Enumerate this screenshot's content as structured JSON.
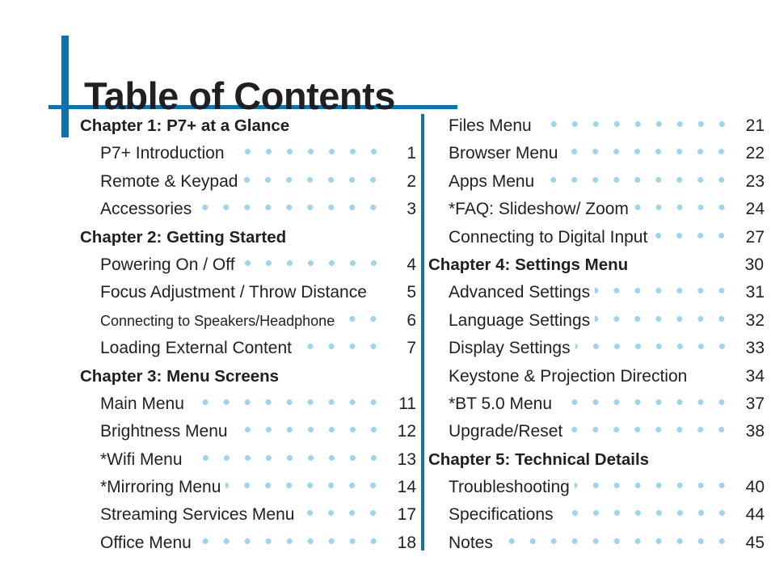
{
  "document": {
    "title": "Table of Contents",
    "accent_color": "#1272a8",
    "leader_dot_color": "#9ed5ea",
    "text_color": "#231f20"
  },
  "toc": {
    "left_column": [
      {
        "label": "Chapter 1: P7+ at a Glance",
        "page": "",
        "type": "chapter",
        "leader": false
      },
      {
        "label": "P7+ Introduction",
        "page": "1",
        "type": "entry",
        "leader": true
      },
      {
        "label": "Remote & Keypad",
        "page": "2",
        "type": "entry",
        "leader": true
      },
      {
        "label": "Accessories",
        "page": "3",
        "type": "entry",
        "leader": true
      },
      {
        "label": "Chapter 2: Getting Started",
        "page": "",
        "type": "chapter",
        "leader": false
      },
      {
        "label": "Powering On / Off",
        "page": "4",
        "type": "entry",
        "leader": true
      },
      {
        "label": "Focus Adjustment / Throw Distance",
        "page": "5",
        "type": "entry",
        "leader": false
      },
      {
        "label": "Connecting to Speakers/Headphone",
        "page": "6",
        "type": "entry-condensed",
        "leader": true
      },
      {
        "label": "Loading External Content",
        "page": "7",
        "type": "entry",
        "leader": true
      },
      {
        "label": "Chapter 3: Menu Screens",
        "page": "",
        "type": "chapter",
        "leader": false
      },
      {
        "label": "Main Menu",
        "page": "11",
        "type": "entry",
        "leader": true
      },
      {
        "label": "Brightness Menu",
        "page": "12",
        "type": "entry",
        "leader": true
      },
      {
        "label": "*Wifi Menu",
        "page": "13",
        "type": "entry",
        "leader": true
      },
      {
        "label": "*Mirroring Menu",
        "page": "14",
        "type": "entry",
        "leader": true
      },
      {
        "label": "Streaming Services Menu",
        "page": "17",
        "type": "entry",
        "leader": true
      },
      {
        "label": "Office Menu",
        "page": "18",
        "type": "entry",
        "leader": true
      }
    ],
    "right_column": [
      {
        "label": "Files Menu",
        "page": "21",
        "type": "entry",
        "leader": true
      },
      {
        "label": "Browser Menu",
        "page": "22",
        "type": "entry",
        "leader": true
      },
      {
        "label": "Apps Menu",
        "page": "23",
        "type": "entry",
        "leader": true
      },
      {
        "label": "*FAQ: Slideshow/ Zoom",
        "page": "24",
        "type": "entry",
        "leader": true
      },
      {
        "label": "Connecting to Digital Input",
        "page": "27",
        "type": "entry",
        "leader": true
      },
      {
        "label": "Chapter 4: Settings Menu",
        "page": "30",
        "type": "chapter",
        "leader": false
      },
      {
        "label": "Advanced Settings",
        "page": "31",
        "type": "entry",
        "leader": true
      },
      {
        "label": "Language Settings",
        "page": "32",
        "type": "entry",
        "leader": true
      },
      {
        "label": "Display Settings",
        "page": "33",
        "type": "entry",
        "leader": true
      },
      {
        "label": "Keystone & Projection Direction",
        "page": "34",
        "type": "entry",
        "leader": false
      },
      {
        "label": "*BT 5.0 Menu",
        "page": "37",
        "type": "entry",
        "leader": true
      },
      {
        "label": "Upgrade/Reset",
        "page": "38",
        "type": "entry",
        "leader": true
      },
      {
        "label": "Chapter 5: Technical Details",
        "page": "",
        "type": "chapter",
        "leader": false
      },
      {
        "label": "Troubleshooting",
        "page": "40",
        "type": "entry",
        "leader": true
      },
      {
        "label": "Specifications",
        "page": "44",
        "type": "entry",
        "leader": true
      },
      {
        "label": "Notes",
        "page": "45",
        "type": "entry",
        "leader": true
      }
    ]
  }
}
